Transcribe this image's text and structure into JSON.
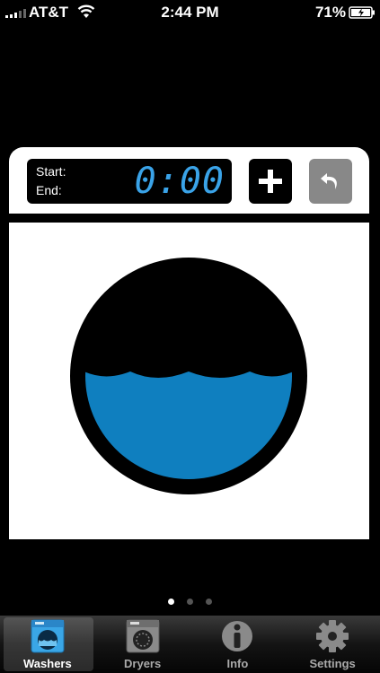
{
  "status_bar": {
    "carrier": "AT&T",
    "time": "2:44 PM",
    "battery_percent": "71%",
    "battery_level": 0.71
  },
  "timer": {
    "start_label": "Start:",
    "end_label": "End:",
    "time_value": "0:00",
    "accent_color": "#3aa3e8"
  },
  "washer": {
    "water_color": "#0f7fbf"
  },
  "pager": {
    "pages": 3,
    "active_page": 1
  },
  "tabs": [
    {
      "label": "Washers",
      "icon": "washer-icon",
      "selected": true
    },
    {
      "label": "Dryers",
      "icon": "dryer-icon",
      "selected": false
    },
    {
      "label": "Info",
      "icon": "info-icon",
      "selected": false
    },
    {
      "label": "Settings",
      "icon": "gear-icon",
      "selected": false
    }
  ]
}
